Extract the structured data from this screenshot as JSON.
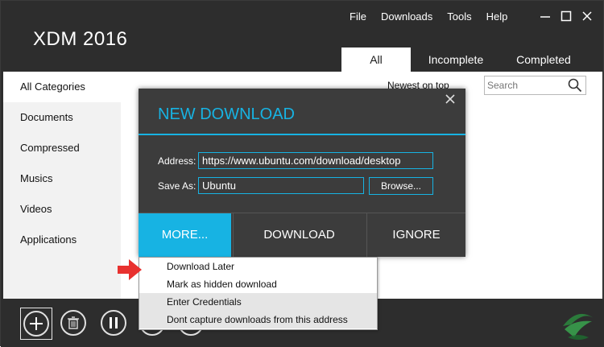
{
  "app": {
    "title": "XDM 2016"
  },
  "menu": [
    "File",
    "Downloads",
    "Tools",
    "Help"
  ],
  "tabs": [
    {
      "label": "All",
      "active": true
    },
    {
      "label": "Incomplete",
      "active": false
    },
    {
      "label": "Completed",
      "active": false
    }
  ],
  "sidebar": {
    "items": [
      {
        "label": "All Categories",
        "active": true
      },
      {
        "label": "Documents",
        "active": false
      },
      {
        "label": "Compressed",
        "active": false
      },
      {
        "label": "Musics",
        "active": false
      },
      {
        "label": "Videos",
        "active": false
      },
      {
        "label": "Applications",
        "active": false
      }
    ]
  },
  "list": {
    "sort_label": "Newest on top",
    "search_placeholder": "Search"
  },
  "dialog": {
    "title": "NEW DOWNLOAD",
    "address_label": "Address:",
    "address_value": "https://www.ubuntu.com/download/desktop",
    "saveas_label": "Save As:",
    "saveas_value": "Ubuntu",
    "browse_label": "Browse...",
    "more_label": "MORE...",
    "download_label": "DOWNLOAD",
    "ignore_label": "IGNORE"
  },
  "popup_menu": {
    "items": [
      "Download Later",
      "Mark as hidden download",
      "Enter Credentials",
      "Dont capture downloads from this address"
    ]
  },
  "colors": {
    "accent": "#17b3e3",
    "window_bg": "#2d2d2d",
    "dialog_bg": "#3c3c3c",
    "arrow": "#e8312f"
  }
}
